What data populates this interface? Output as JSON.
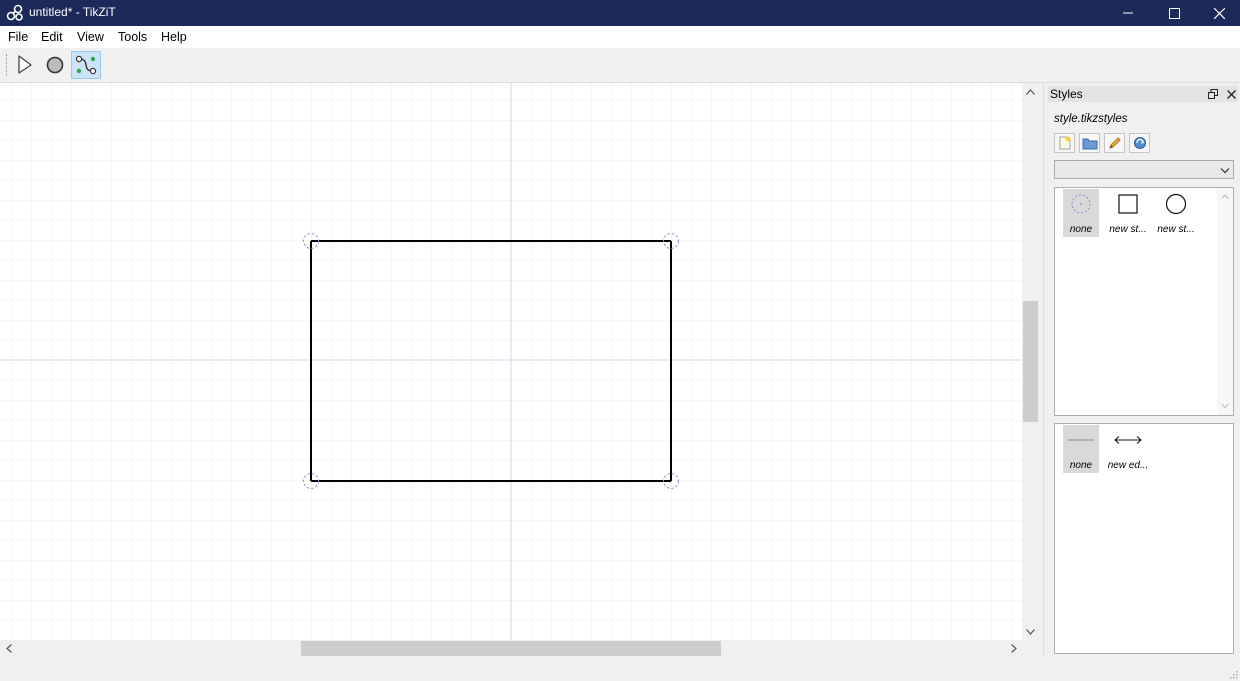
{
  "window": {
    "title": "untitled* - TikZiT",
    "controls": [
      "minimize-icon",
      "maximize-icon",
      "close-icon"
    ]
  },
  "menu": [
    "File",
    "Edit",
    "View",
    "Tools",
    "Help"
  ],
  "toolbar": {
    "tools": [
      {
        "name": "select-tool",
        "icon": "pointer-arrow-icon",
        "active": false
      },
      {
        "name": "node-tool",
        "icon": "circle-node-icon",
        "active": false
      },
      {
        "name": "edge-tool",
        "icon": "edge-curve-icon",
        "active": true
      }
    ]
  },
  "canvas": {
    "grid_color": "#e8e8ee",
    "axis_color": "#d6d6ec",
    "edge_color": "#000000",
    "node_style": "none",
    "node_count": 4,
    "edges": "rectangle"
  },
  "styles_panel": {
    "title": "Styles",
    "file": "style.tikzstyles",
    "buttons": [
      "new-file-icon",
      "open-folder-icon",
      "edit-pencil-icon",
      "refresh-icon"
    ],
    "combo_value": "",
    "node_styles": [
      {
        "label": "none",
        "shape": "dotted-circle",
        "selected": true
      },
      {
        "label": "new st...",
        "shape": "square",
        "selected": false
      },
      {
        "label": "new st...",
        "shape": "circle",
        "selected": false
      }
    ],
    "edge_styles": [
      {
        "label": "none",
        "shape": "line",
        "selected": true
      },
      {
        "label": "new ed...",
        "shape": "double-arrow",
        "selected": false
      }
    ]
  }
}
